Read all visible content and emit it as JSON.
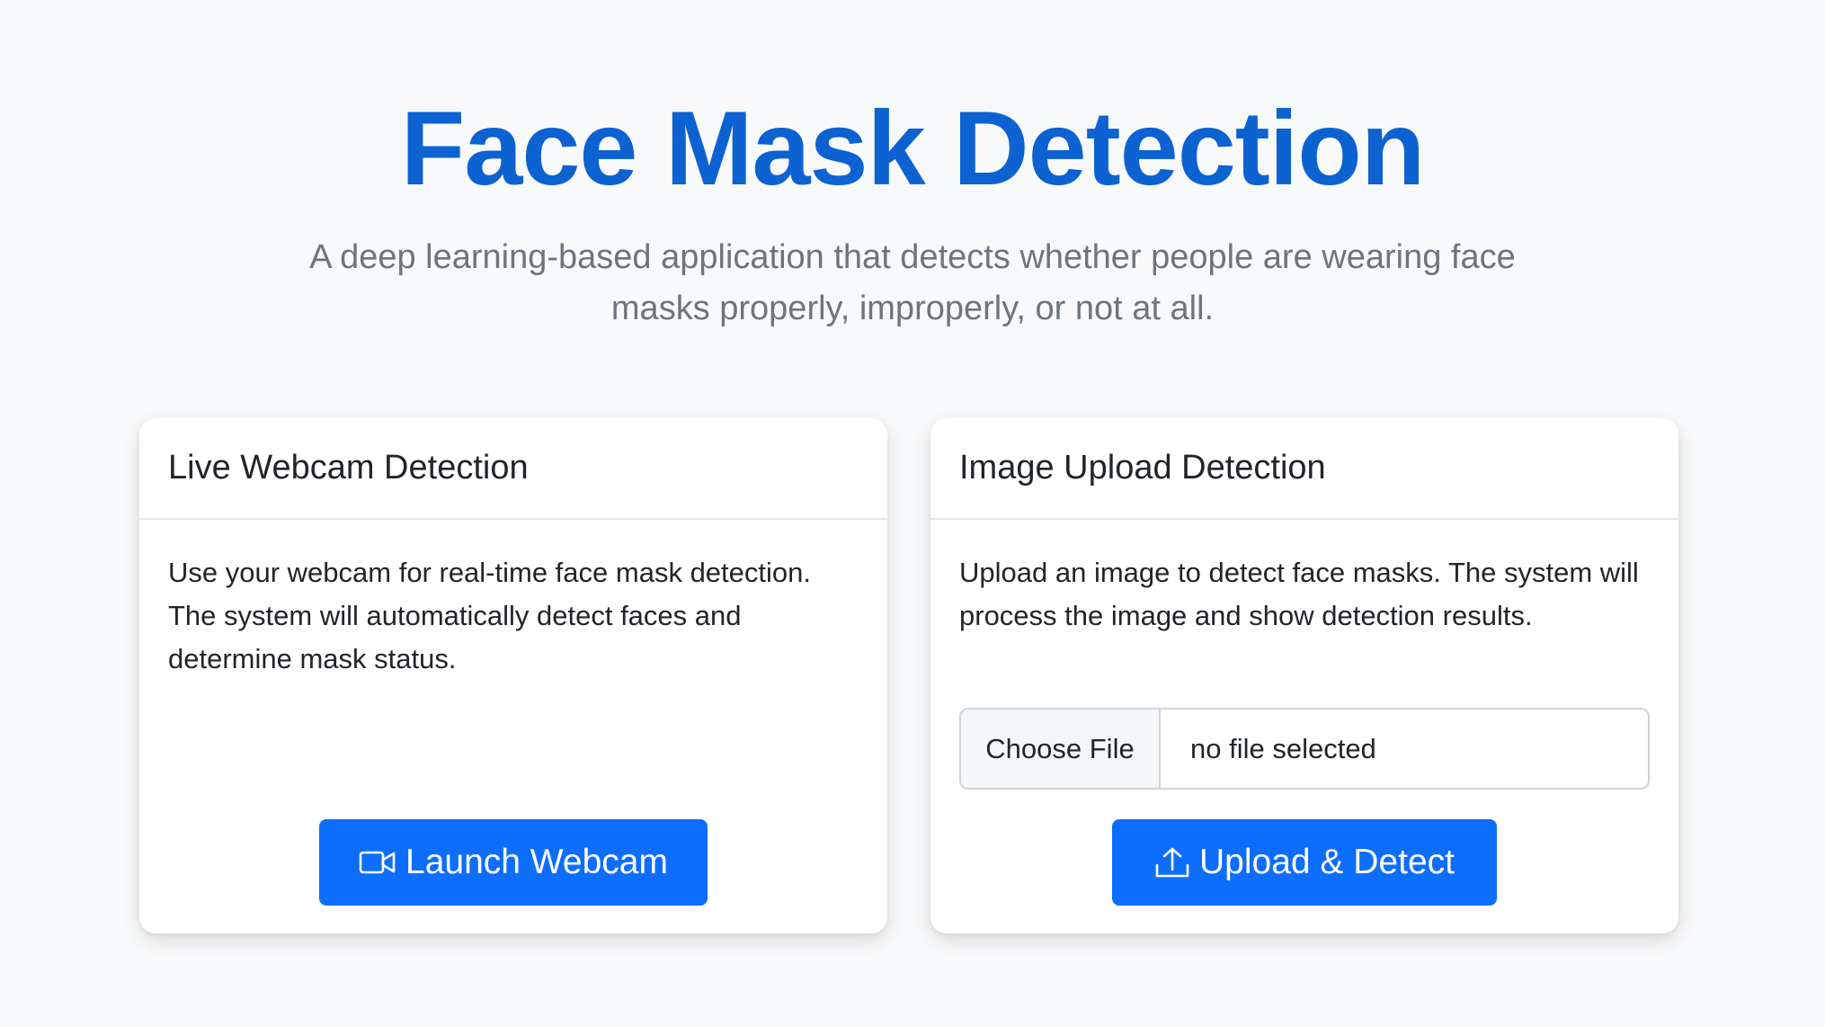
{
  "header": {
    "title": "Face Mask Detection",
    "subtitle": "A deep learning-based application that detects whether people are wearing face masks properly, improperly, or not at all."
  },
  "webcam_card": {
    "title": "Live Webcam Detection",
    "description": "Use your webcam for real-time face mask detection. The system will automatically detect faces and determine mask status.",
    "button_label": "Launch Webcam",
    "button_icon": "video-camera-icon"
  },
  "upload_card": {
    "title": "Image Upload Detection",
    "description": "Upload an image to detect face masks. The system will process the image and show detection results.",
    "file_button_label": "Choose File",
    "file_status": "no file selected",
    "button_label": "Upload & Detect",
    "button_icon": "upload-icon"
  },
  "colors": {
    "title": "#0d62d2",
    "primary": "#0d6efd",
    "background": "#f8f9fa",
    "muted_text": "#6c757d"
  }
}
